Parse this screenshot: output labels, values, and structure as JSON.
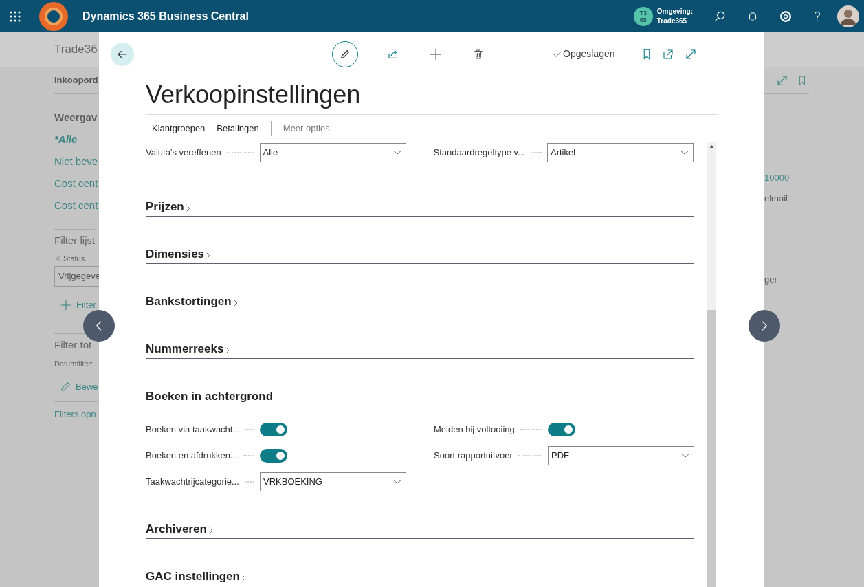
{
  "topbar": {
    "title": "Dynamics 365 Business Central",
    "avatar_initials": "T3 65",
    "environment_label": "Omgeving:",
    "environment": "Trade365"
  },
  "background_page": {
    "title": "Trade36",
    "left_items": [
      {
        "kind": "tab",
        "text": "Inkoopord"
      },
      {
        "kind": "heading",
        "text": "Weergav"
      },
      {
        "kind": "view",
        "text": "*Alle",
        "selected": true
      },
      {
        "kind": "view",
        "text": "Niet beve",
        "selected": false
      },
      {
        "kind": "view",
        "text": "Cost cent",
        "selected": false
      },
      {
        "kind": "view",
        "text": "Cost cent",
        "selected": false
      },
      {
        "kind": "filter_heading",
        "text": "Filter lijst"
      },
      {
        "kind": "chip",
        "text": "Status"
      },
      {
        "kind": "input",
        "text": "Vrijgegeve"
      },
      {
        "kind": "add",
        "text": "Filter"
      },
      {
        "kind": "filter_heading",
        "text": "Filter tot"
      },
      {
        "kind": "caption",
        "text": "Datumfilter:"
      },
      {
        "kind": "edit",
        "text": "Bewe"
      },
      {
        "kind": "link",
        "text": "Filters opn"
      }
    ],
    "right_items": [
      {
        "kind": "link",
        "text": "10000"
      },
      {
        "kind": "text",
        "text": "elmail"
      },
      {
        "kind": "text",
        "text": "ger"
      }
    ]
  },
  "modal": {
    "title": "Verkoopinstellingen",
    "saved": "Opgeslagen",
    "actions": [
      "Klantgroepen",
      "Betalingen"
    ],
    "more": "Meer opties",
    "top_fields": [
      {
        "kind": "select",
        "label": "Valuta's vereffenen",
        "value": "Alle"
      },
      {
        "kind": "select",
        "label": "Standaardregeltype v...",
        "value": "Artikel"
      }
    ],
    "sections": [
      {
        "title": "Prijzen",
        "expanded": false
      },
      {
        "title": "Dimensies",
        "expanded": false
      },
      {
        "title": "Bankstortingen",
        "expanded": false
      },
      {
        "title": "Nummerreeks",
        "expanded": false
      },
      {
        "title": "Boeken in achtergrond",
        "expanded": true,
        "fields": [
          {
            "kind": "toggle",
            "label": "Boeken via taakwacht...",
            "on": true
          },
          {
            "kind": "toggle",
            "label": "Melden bij voltooiing",
            "on": true
          },
          {
            "kind": "toggle",
            "label": "Boeken en afdrukken...",
            "on": true
          },
          {
            "kind": "select",
            "label": "Soort rapportuitvoer",
            "value": "PDF"
          },
          {
            "kind": "select",
            "label": "Taakwachtrijcategorie...",
            "value": "VRKBOEKING"
          }
        ]
      },
      {
        "title": "Archiveren",
        "expanded": false
      },
      {
        "title": "GAC instellingen",
        "expanded": false
      }
    ]
  }
}
